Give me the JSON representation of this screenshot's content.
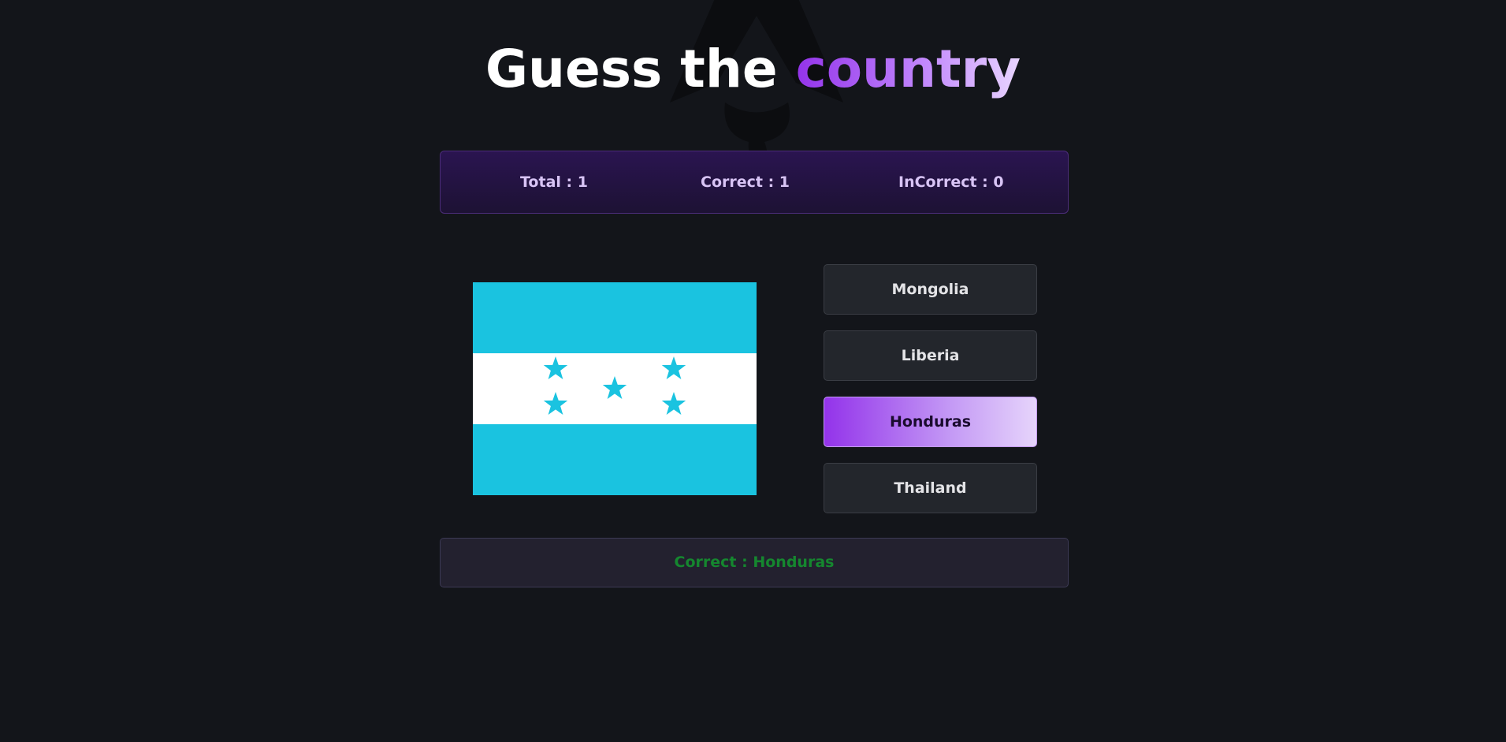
{
  "header": {
    "title_prefix": "Guess the ",
    "title_accent": "country"
  },
  "score": {
    "total_label": "Total : 1",
    "correct_label": "Correct : 1",
    "incorrect_label": "InCorrect : 0"
  },
  "flag": {
    "icon": "honduras-flag",
    "colors": {
      "blue": "#1ac3e0",
      "white": "#ffffff"
    }
  },
  "options": [
    {
      "label": "Mongolia",
      "selected": false
    },
    {
      "label": "Liberia",
      "selected": false
    },
    {
      "label": "Honduras",
      "selected": true
    },
    {
      "label": "Thailand",
      "selected": false
    }
  ],
  "result": {
    "text": "Correct : Honduras",
    "color": "#15872f"
  },
  "theme": {
    "background": "#13151a",
    "accent": "#9333ea",
    "accent_light": "#e6d4fb"
  }
}
